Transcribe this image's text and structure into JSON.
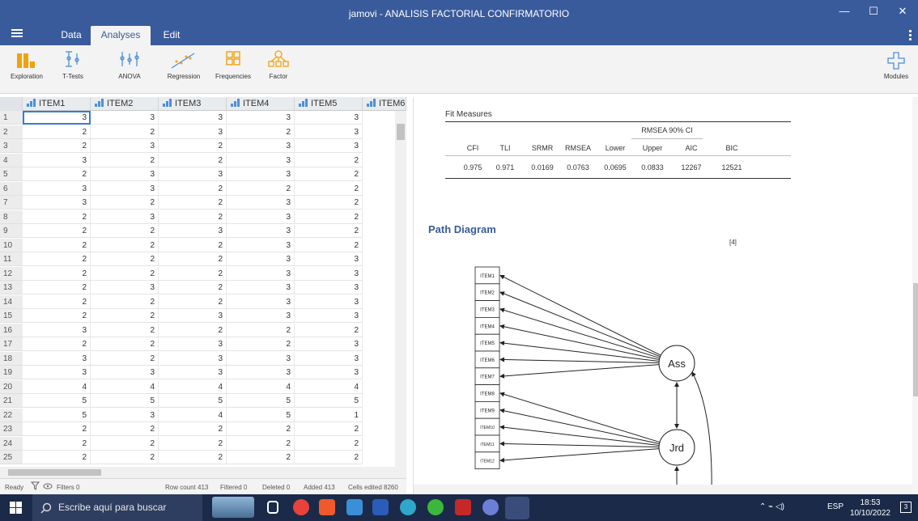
{
  "window": {
    "title": "jamovi - ANALISIS FACTORIAL CONFIRMATORIO",
    "minimize": "—",
    "maximize": "☐",
    "close": "✕"
  },
  "menu": {
    "tabs": [
      "Data",
      "Analyses",
      "Edit"
    ],
    "active_tab": "Analyses"
  },
  "ribbon": {
    "items": [
      "Exploration",
      "T-Tests",
      "ANOVA",
      "Regression",
      "Frequencies",
      "Factor"
    ],
    "modules_label": "Modules"
  },
  "grid": {
    "columns": [
      "ITEM1",
      "ITEM2",
      "ITEM3",
      "ITEM4",
      "ITEM5",
      "ITEM6"
    ],
    "rows": [
      [
        3,
        3,
        3,
        3,
        3
      ],
      [
        2,
        2,
        3,
        2,
        3
      ],
      [
        2,
        3,
        2,
        3,
        3
      ],
      [
        3,
        2,
        2,
        3,
        2
      ],
      [
        2,
        3,
        3,
        3,
        2
      ],
      [
        3,
        3,
        2,
        2,
        2
      ],
      [
        3,
        2,
        2,
        3,
        2
      ],
      [
        2,
        3,
        2,
        3,
        2
      ],
      [
        2,
        2,
        3,
        3,
        2
      ],
      [
        2,
        2,
        2,
        3,
        2
      ],
      [
        2,
        2,
        2,
        3,
        3
      ],
      [
        2,
        2,
        2,
        3,
        3
      ],
      [
        2,
        3,
        2,
        3,
        3
      ],
      [
        2,
        2,
        2,
        3,
        3
      ],
      [
        2,
        2,
        3,
        3,
        3
      ],
      [
        3,
        2,
        2,
        2,
        2
      ],
      [
        2,
        2,
        3,
        2,
        3
      ],
      [
        3,
        2,
        3,
        3,
        3
      ],
      [
        3,
        3,
        3,
        3,
        3
      ],
      [
        4,
        4,
        4,
        4,
        4
      ],
      [
        5,
        5,
        5,
        5,
        5
      ],
      [
        5,
        3,
        4,
        5,
        1
      ],
      [
        2,
        2,
        2,
        2,
        2
      ],
      [
        2,
        2,
        2,
        2,
        2
      ],
      [
        2,
        2,
        2,
        2,
        2
      ]
    ]
  },
  "status": {
    "ready": "Ready",
    "filters": "Filters 0",
    "row_count": "Row count 413",
    "filtered": "Filtered 0",
    "deleted": "Deleted 0",
    "added": "Added 413",
    "cells_edited": "Cells edited 8260"
  },
  "results": {
    "fit_title": "Fit Measures",
    "ci_header": "RMSEA 90% CI",
    "headers": [
      "CFI",
      "TLI",
      "SRMR",
      "RMSEA",
      "Lower",
      "Upper",
      "AIC",
      "BIC"
    ],
    "values": [
      "0.975",
      "0.971",
      "0.0169",
      "0.0763",
      "0.0695",
      "0.0833",
      "12267",
      "12521"
    ],
    "path_title": "Path Diagram",
    "ref": "[4]",
    "items": [
      "ITEM1",
      "ITEM2",
      "ITEM3",
      "ITEM4",
      "ITEM5",
      "ITEM6",
      "ITEM7",
      "ITEM8",
      "ITEM9",
      "ITEM10",
      "ITEM11",
      "ITEM12"
    ],
    "factors": [
      "Ass",
      "Jrd"
    ]
  },
  "taskbar": {
    "search_placeholder": "Escribe aquí para buscar",
    "lang": "ESP",
    "time": "18:53",
    "date": "10/10/2022",
    "notif_count": "3"
  }
}
